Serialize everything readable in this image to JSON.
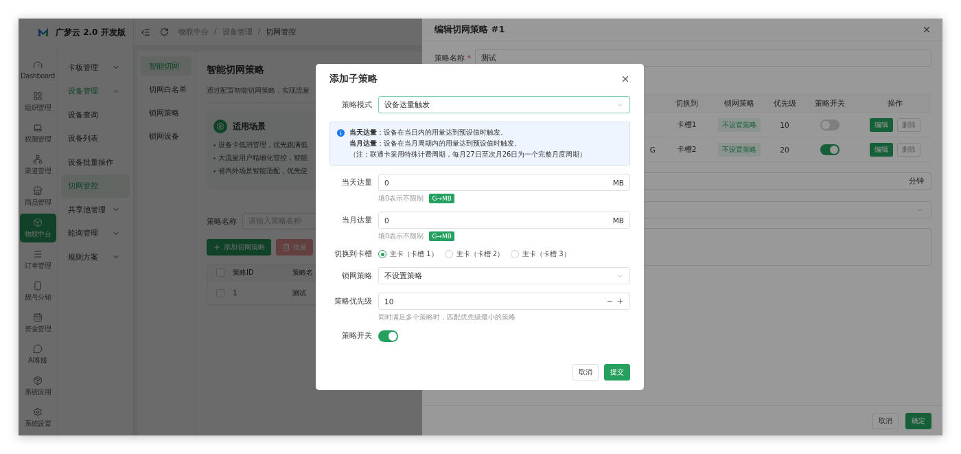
{
  "logo": {
    "text": "广梦云 2.0 开发版"
  },
  "rail": [
    {
      "label": "Dashboard",
      "selected": false
    },
    {
      "label": "组织管理",
      "selected": false
    },
    {
      "label": "权限管理",
      "selected": false
    },
    {
      "label": "渠道管理",
      "selected": false
    },
    {
      "label": "商品管理",
      "selected": false
    },
    {
      "label": "物联中台",
      "selected": true
    },
    {
      "label": "订单管理",
      "selected": false
    },
    {
      "label": "靓号分销",
      "selected": false
    },
    {
      "label": "资金管理",
      "selected": false
    },
    {
      "label": "AI客服",
      "selected": false
    },
    {
      "label": "系统应用",
      "selected": false
    },
    {
      "label": "系统设置",
      "selected": false
    }
  ],
  "menu": [
    {
      "label": "卡板管理",
      "expanded": false,
      "selected": false
    },
    {
      "label": "设备管理",
      "expanded": true,
      "selected": true,
      "children": [
        {
          "label": "设备查询",
          "selected": false
        },
        {
          "label": "设备列表",
          "selected": false
        },
        {
          "label": "设备批量操作",
          "selected": false
        },
        {
          "label": "切网管控",
          "selected": true
        }
      ]
    },
    {
      "label": "共享池管理",
      "expanded": false,
      "selected": false
    },
    {
      "label": "轮询管理",
      "expanded": false,
      "selected": false
    },
    {
      "label": "规则方案",
      "expanded": false,
      "selected": false
    }
  ],
  "breadcrumb": [
    "物联中台",
    "设备管理",
    "切网管控"
  ],
  "breadcrumb_separator": "/",
  "tabs": [
    {
      "label": "智能切网",
      "selected": true
    },
    {
      "label": "切网白名单",
      "selected": false
    },
    {
      "label": "锁网策略",
      "selected": false
    },
    {
      "label": "锁网设备",
      "selected": false
    }
  ],
  "page": {
    "title": "智能切网策略",
    "description": "通过配置智能切网策略，实现流量",
    "scenario": {
      "title": "适用场景",
      "items": [
        "设备卡低消管理，优先跑满低",
        "大流量用户精细化管控，智能",
        "省内外场景智能适配，优先使"
      ]
    }
  },
  "filter": {
    "label": "策略名称",
    "placeholder": "请输入策略名称"
  },
  "actions": [
    {
      "label": "添加切网策略",
      "kind": "primary"
    },
    {
      "label": "批量",
      "kind": "danger"
    }
  ],
  "table": {
    "select_all": {
      "checked": false
    },
    "columns": [
      "策略ID",
      "策略名"
    ],
    "rows": [
      {
        "checked": false,
        "cells": [
          "1",
          "测试"
        ]
      }
    ]
  },
  "drawer": {
    "title": "编辑切网策略 #1",
    "name_label": "策略名称",
    "required_mark": "*",
    "name_value": "测试",
    "table": {
      "columns": [
        "切换到",
        "锁网策略",
        "优先级",
        "策略开关",
        "操作"
      ],
      "rows": [
        {
          "switch_to": "卡槽1",
          "lock_policy": "不设置策略",
          "priority": "10",
          "on": false,
          "actions": [
            "编辑",
            "删除"
          ]
        },
        {
          "fragment": "G",
          "switch_to": "卡槽2",
          "lock_policy": "不设置策略",
          "priority": "20",
          "on": true,
          "actions": [
            "编辑",
            "删除"
          ]
        }
      ]
    },
    "interval_unit": "分钟",
    "buttons": [
      {
        "label": "取消",
        "kind": "default"
      },
      {
        "label": "确定",
        "kind": "primary"
      }
    ]
  },
  "modal": {
    "title": "添加子策略",
    "fields": [
      {
        "kind": "select",
        "label": "策略模式",
        "value": "设备达量触发",
        "focused": true
      },
      {
        "kind": "alert",
        "lines": [
          "**当天达量**：设备在当日内的用量达到预设值时触发。",
          "**当月达量**：设备在当月周期内的用量达到预设值时触发。",
          "（注：联通卡采用特殊计费周期，每月27日至次月26日为一个完整月度周期）"
        ]
      },
      {
        "kind": "unit_input",
        "label": "当天达量",
        "value": "0",
        "unit": "MB",
        "hint": "填0表示不限制",
        "tag": "G→MB"
      },
      {
        "kind": "unit_input",
        "label": "当月达量",
        "value": "0",
        "unit": "MB",
        "hint": "填0表示不限制",
        "tag": "G→MB"
      },
      {
        "kind": "radio",
        "label": "切换到卡槽",
        "options": [
          {
            "label": "主卡（卡槽 1）",
            "selected": true
          },
          {
            "label": "主卡（卡槽 2）",
            "selected": false
          },
          {
            "label": "主卡（卡槽 3）",
            "selected": false
          }
        ]
      },
      {
        "kind": "select",
        "label": "锁网策略",
        "value": "不设置策略",
        "focused": false
      },
      {
        "kind": "stepper",
        "label": "策略优先级",
        "value": "10",
        "hint": "同时满足多个策略时，匹配优先级最小的策略"
      },
      {
        "kind": "switch",
        "label": "策略开关",
        "on": true
      }
    ],
    "buttons": [
      {
        "label": "取消",
        "kind": "default"
      },
      {
        "label": "提交",
        "kind": "primary"
      }
    ]
  }
}
